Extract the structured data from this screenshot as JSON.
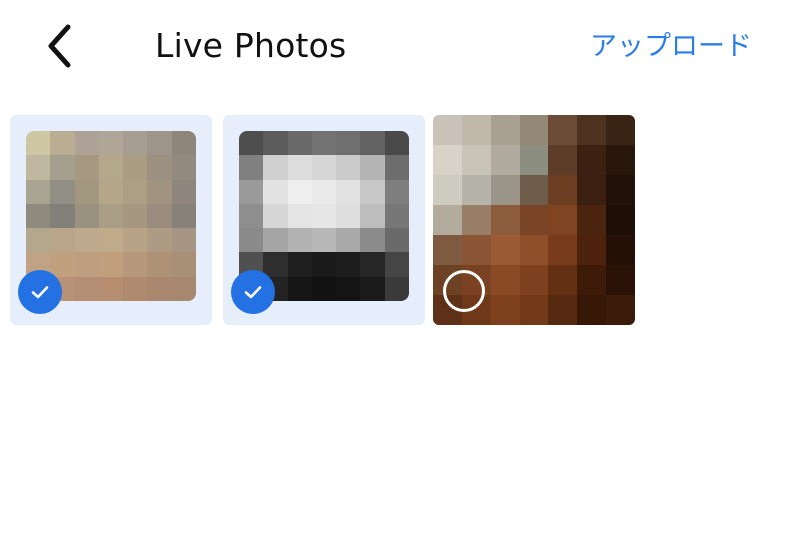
{
  "header": {
    "back_icon": "chevron-left-icon",
    "title": "Live Photos",
    "upload_label": "アップロード"
  },
  "photos": [
    {
      "selected": true,
      "status_icon": "checkmark-icon",
      "pixel_colors": [
        [
          "#cdc7a4",
          "#b9ae93",
          "#aea296",
          "#b0a698",
          "#a69e90",
          "#9e958a",
          "#8e857b"
        ],
        [
          "#bfb7a0",
          "#a59f8d",
          "#a59982",
          "#b3a78c",
          "#aa9d84",
          "#9c9181",
          "#938a7f"
        ],
        [
          "#a9a392",
          "#918e83",
          "#a2977f",
          "#b3a689",
          "#ad9f84",
          "#a09481",
          "#8e857c"
        ],
        [
          "#8f8a7e",
          "#828179",
          "#9b917f",
          "#ab9e86",
          "#a59780",
          "#998c7d",
          "#88817a"
        ],
        [
          "#b3a78c",
          "#b8a58a",
          "#bda98b",
          "#bfaa8a",
          "#b8a386",
          "#ad9b83",
          "#a59582"
        ],
        [
          "#c1a284",
          "#c1a080",
          "#be9e7e",
          "#c19f7c",
          "#b7987a",
          "#ad9276",
          "#a79075"
        ],
        [
          "#ba967a",
          "#b89176",
          "#b48e74",
          "#b68d70",
          "#b08a6f",
          "#a9876e",
          "#a6876f"
        ]
      ]
    },
    {
      "selected": true,
      "status_icon": "checkmark-icon",
      "pixel_colors": [
        [
          "#4e4e4e",
          "#5c5c5c",
          "#6a6a6a",
          "#737373",
          "#6f6f6f",
          "#626262",
          "#4a4a4a"
        ],
        [
          "#808080",
          "#cfcfcf",
          "#dcdcdc",
          "#d6d6d6",
          "#cacaca",
          "#b4b4b4",
          "#6d6d6d"
        ],
        [
          "#9a9a9a",
          "#e2e2e2",
          "#eeeeee",
          "#eaeaea",
          "#e2e2e2",
          "#c8c8c8",
          "#7e7e7e"
        ],
        [
          "#8e8e8e",
          "#d6d6d6",
          "#e4e4e4",
          "#e6e6e6",
          "#dedede",
          "#bdbdbd",
          "#777777"
        ],
        [
          "#8a8a8a",
          "#a6a6a6",
          "#b2b2b2",
          "#b8b8b8",
          "#a9a9a9",
          "#8b8b8b",
          "#6a6a6a"
        ],
        [
          "#505050",
          "#2e2e2e",
          "#1e1e1e",
          "#1a1a1a",
          "#1d1d1d",
          "#262626",
          "#454545"
        ],
        [
          "#3e3e3e",
          "#232323",
          "#161616",
          "#121212",
          "#141414",
          "#1b1b1b",
          "#3a3a3a"
        ]
      ]
    },
    {
      "selected": false,
      "status_icon": "unselected-circle-icon",
      "pixel_colors": [
        [
          "#c8c2b8",
          "#bfb8ab",
          "#a8a093",
          "#948877",
          "#6c4c36",
          "#4e3220",
          "#3a2416"
        ],
        [
          "#d7d3c9",
          "#c9c4b8",
          "#b1ab9f",
          "#8c8e80",
          "#5d3d27",
          "#3c2112",
          "#2a170c"
        ],
        [
          "#cecbc0",
          "#b6b3a8",
          "#9a9589",
          "#6e5c4a",
          "#6d3e22",
          "#3b1f10",
          "#211108"
        ],
        [
          "#b3ac9d",
          "#987e66",
          "#8c5c3d",
          "#7a4526",
          "#7f4522",
          "#4a240f",
          "#1f0e05"
        ],
        [
          "#7e5a41",
          "#8a5535",
          "#9b5c35",
          "#8f4f2a",
          "#783c1d",
          "#4c220c",
          "#241006"
        ],
        [
          "#6d4124",
          "#7a4223",
          "#8a4a26",
          "#7e401f",
          "#633014",
          "#3e1a08",
          "#2a1207"
        ],
        [
          "#5e3017",
          "#6e3819",
          "#7f401e",
          "#733a1a",
          "#562a10",
          "#371706",
          "#3b1b0a"
        ]
      ]
    }
  ],
  "colors": {
    "accent": "#2b7de9",
    "check_badge": "#2371e3",
    "selected_tile_bg": "#e6edfb",
    "title_text": "#111111"
  }
}
